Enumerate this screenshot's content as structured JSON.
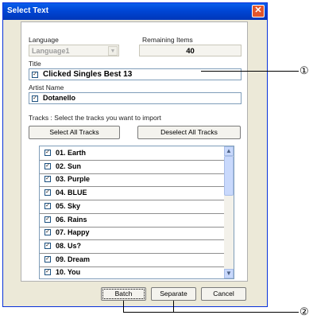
{
  "window": {
    "title": "Select Text"
  },
  "language": {
    "label": "Language",
    "value": "Language1"
  },
  "remaining": {
    "label": "Remaining Items",
    "value": "40"
  },
  "title_field": {
    "label": "Title",
    "value": "Clicked Singles Best 13"
  },
  "artist_field": {
    "label": "Artist Name",
    "value": "Dotanello"
  },
  "tracks": {
    "instruction": "Tracks   : Select the tracks you want to import",
    "select_all": "Select All Tracks",
    "deselect_all": "Deselect All Tracks",
    "items": [
      {
        "label": "01. Earth",
        "checked": true
      },
      {
        "label": "02. Sun",
        "checked": true
      },
      {
        "label": "03. Purple",
        "checked": true
      },
      {
        "label": "04. BLUE",
        "checked": true
      },
      {
        "label": "05. Sky",
        "checked": true
      },
      {
        "label": "06. Rains",
        "checked": true
      },
      {
        "label": "07. Happy",
        "checked": true
      },
      {
        "label": "08. Us?",
        "checked": true
      },
      {
        "label": "09. Dream",
        "checked": true
      },
      {
        "label": "10. You",
        "checked": true
      }
    ]
  },
  "buttons": {
    "batch": "Batch",
    "separate": "Separate",
    "cancel": "Cancel"
  },
  "callouts": {
    "one": "①",
    "two": "②"
  },
  "glyphs": {
    "close": "✕",
    "check": "✓",
    "arrow_up": "▲",
    "arrow_down": "▼"
  }
}
